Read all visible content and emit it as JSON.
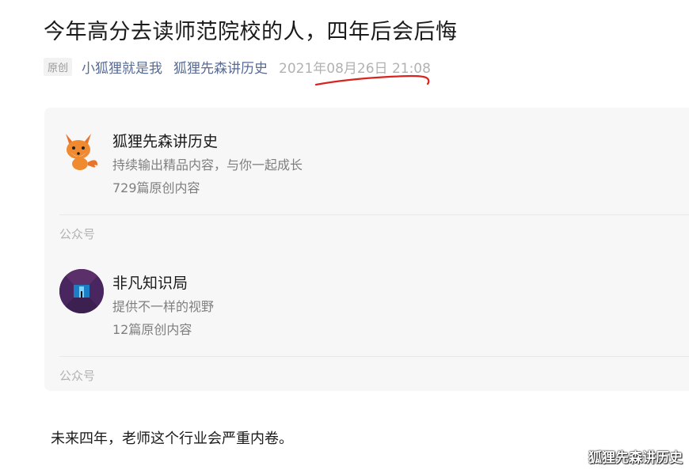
{
  "article": {
    "title": "今年高分去读师范院校的人，四年后会后悔",
    "badge": "原创",
    "author": "小狐狸就是我",
    "account": "狐狸先森讲历史",
    "date": "2021年08月26日 21:08",
    "body": "未来四年，老师这个行业会严重内卷。"
  },
  "profiles": [
    {
      "name": "狐狸先森讲历史",
      "description": "持续输出精品内容，与你一起成长",
      "count": "729篇原创内容",
      "type": "公众号",
      "avatar_icon": "fox-avatar-icon"
    },
    {
      "name": "非凡知识局",
      "description": "提供不一样的视野",
      "count": "12篇原创内容",
      "type": "公众号",
      "avatar_icon": "corridor-avatar-icon"
    }
  ],
  "watermark": "狐狸先森讲历史",
  "colors": {
    "link": "#576b95",
    "date": "#b2b2b2",
    "card_bg": "#f7f7f7",
    "annotation": "#d9231e"
  }
}
